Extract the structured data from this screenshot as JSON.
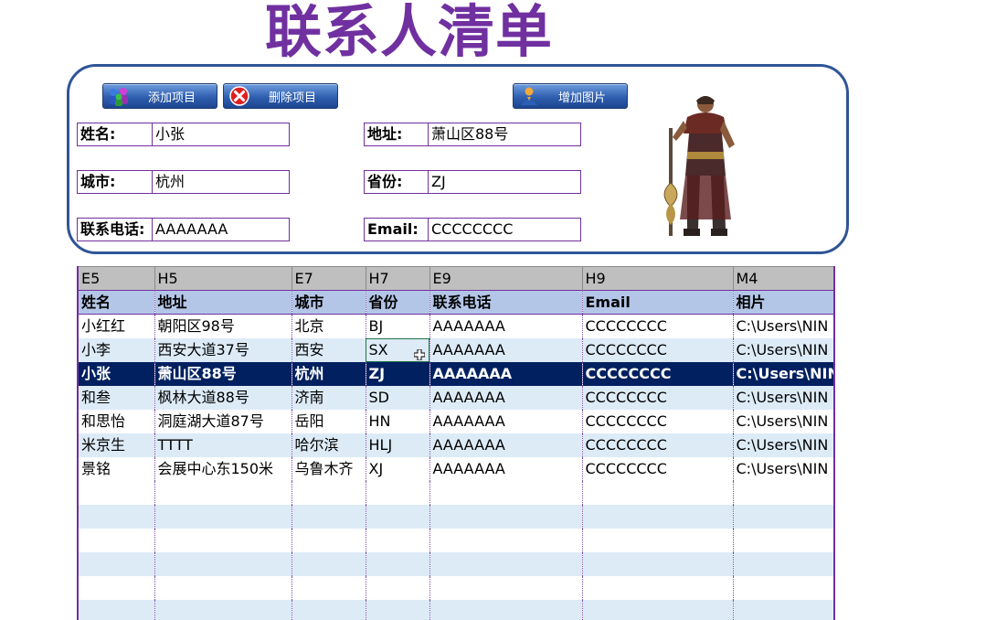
{
  "title": "联系人清单",
  "buttons": {
    "add": "添加项目",
    "delete": "删除项目",
    "add_image": "增加图片"
  },
  "form": {
    "name_label": "姓名:",
    "name_value": "小张",
    "address_label": "地址:",
    "address_value": "萧山区88号",
    "city_label": "城市:",
    "city_value": "杭州",
    "province_label": "省份:",
    "province_value": "ZJ",
    "phone_label": "联系电话:",
    "phone_value": "AAAAAAA",
    "email_label": "Email:",
    "email_value": "CCCCCCCC"
  },
  "grid": {
    "refs": [
      "E5",
      "H5",
      "E7",
      "H7",
      "E9",
      "H9",
      "M4"
    ],
    "headers": [
      "姓名",
      "地址",
      "城市",
      "省份",
      "联系电话",
      "Email",
      "相片"
    ],
    "rows": [
      [
        "小红红",
        "朝阳区98号",
        "北京",
        "BJ",
        "AAAAAAA",
        "CCCCCCCC",
        "C:\\Users\\NIN"
      ],
      [
        "小李",
        "西安大道37号",
        "西安",
        "SX",
        "AAAAAAA",
        "CCCCCCCC",
        "C:\\Users\\NIN"
      ],
      [
        "小张",
        "萧山区88号",
        "杭州",
        "ZJ",
        "AAAAAAA",
        "CCCCCCCC",
        "C:\\Users\\NIN"
      ],
      [
        "和叁",
        "枫林大道88号",
        "济南",
        "SD",
        "AAAAAAA",
        "CCCCCCCC",
        "C:\\Users\\NIN"
      ],
      [
        "和思怡",
        "洞庭湖大道87号",
        "岳阳",
        "HN",
        "AAAAAAA",
        "CCCCCCCC",
        "C:\\Users\\NIN"
      ],
      [
        "米京生",
        "TTTT",
        "哈尔滨",
        "HLJ",
        "AAAAAAA",
        "CCCCCCCC",
        "C:\\Users\\NIN"
      ],
      [
        "景铭",
        "会展中心东150米",
        "乌鲁木齐",
        "XJ",
        "AAAAAAA",
        "CCCCCCCC",
        "C:\\Users\\NIN"
      ]
    ],
    "empty_rows": 6,
    "selected_row": 2,
    "active_cell": [
      1,
      3
    ]
  },
  "icons": {
    "add": "people-group-icon",
    "delete": "red-x-circle-icon",
    "add_image": "person-badge-icon",
    "cursor": "cell-select-cross-cursor"
  },
  "colors": {
    "title": "#7030a0",
    "panel_border": "#2f5597",
    "header_fill": "#b4c6e7",
    "band_fill": "#ddebf7",
    "selected_fill": "#002060",
    "ref_fill": "#bfbfbf"
  }
}
